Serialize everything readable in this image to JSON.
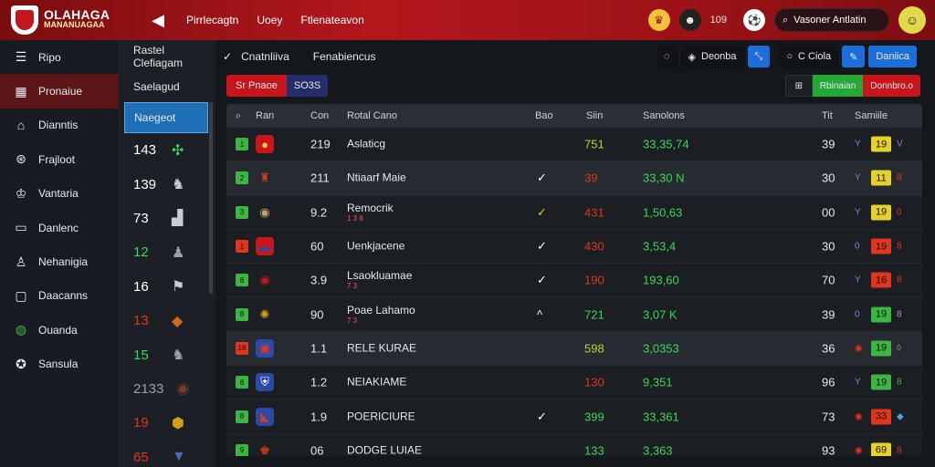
{
  "app": {
    "logo_line1": "OLAHAGA",
    "logo_line2": "MANANUAGAA"
  },
  "topnav": [
    "Pirrlecagtn",
    "Uoey",
    "Ftlenateavon"
  ],
  "top_right": {
    "count": "109",
    "search_value": "Vasoner Antlatin"
  },
  "sidebar": {
    "items": [
      {
        "label": "Ripo",
        "icon": "list-icon"
      },
      {
        "label": "Pronaiue",
        "icon": "calendar-icon"
      },
      {
        "label": "Dianntis",
        "icon": "bank-icon"
      },
      {
        "label": "Frajloot",
        "icon": "ball-icon"
      },
      {
        "label": "Vantaria",
        "icon": "crown-icon"
      },
      {
        "label": "Danlenc",
        "icon": "monitor-icon"
      },
      {
        "label": "Nehanigia",
        "icon": "runner-icon"
      },
      {
        "label": "Daacanns",
        "icon": "tv-icon"
      },
      {
        "label": "Ouanda",
        "icon": "globe-icon"
      },
      {
        "label": "Sansula",
        "icon": "soccer-icon"
      }
    ]
  },
  "midcol": {
    "header": "Rastel Clefiagam",
    "tabhead": "Saelagud",
    "selected": "Naegeot",
    "items": [
      {
        "value": "143",
        "color": "#ffffff",
        "icon": "✣",
        "icon_color": "#3dd65a"
      },
      {
        "value": "139",
        "color": "#ffffff",
        "icon": "♞",
        "icon_color": "#c8ccd2"
      },
      {
        "value": "73",
        "color": "#ffffff",
        "icon": "▟",
        "icon_color": "#c8ccd2"
      },
      {
        "value": "12",
        "color": "#3dd65a",
        "icon": "♟",
        "icon_color": "#9aa0a8"
      },
      {
        "value": "16",
        "color": "#ffffff",
        "icon": "⚑",
        "icon_color": "#c8ccd2"
      },
      {
        "value": "13",
        "color": "#e0361f",
        "icon": "◆",
        "icon_color": "#d2691e"
      },
      {
        "value": "15",
        "color": "#3dd65a",
        "icon": "♞",
        "icon_color": "#9aa0a8"
      },
      {
        "value": "2133",
        "color": "#9aa0a8",
        "icon": "◉",
        "icon_color": "#7a3b2a"
      },
      {
        "value": "19",
        "color": "#e0361f",
        "icon": "⬢",
        "icon_color": "#d4a017"
      },
      {
        "value": "65",
        "color": "#e0361f",
        "icon": "▼",
        "icon_color": "#4a6ab5"
      }
    ]
  },
  "toolbar": {
    "filter_label": "Cnatnliiva",
    "sort_label": "Fenabiencus",
    "btn1": "Deonba",
    "btn2": "C Ciola",
    "btn3": "Daniica",
    "seg_red": "Sr Pnaoe",
    "seg_blue": "SO3S",
    "green": "Rbinaian",
    "red": "Donnbro.o"
  },
  "table": {
    "headers": {
      "col1": "Ran",
      "col2": "Con",
      "col3": "Rotal Cano",
      "col4": "Bao",
      "col5": "Siin",
      "col6": "Sanolons",
      "col7": "Tit",
      "col8": "Samiile"
    },
    "rows": [
      {
        "badge": "1",
        "badge_color": "green",
        "emblem": "●",
        "emblem_bg": "#c8161b",
        "emblem_color": "#f4d03f",
        "con": "219",
        "name": "Aslaticg",
        "sub": "",
        "check": "",
        "check_color": "#ffffff",
        "siin": "751",
        "siin_color": "#b8d430",
        "sanolons": "33,35,74",
        "tit": "39",
        "mini1": "Y",
        "mini1_color": "#6a8de0",
        "chip": "19",
        "chip_color": "#e5d12a",
        "mini2": "V",
        "mini2_color": "#9b7cc9",
        "hl": false
      },
      {
        "badge": "2",
        "badge_color": "green",
        "emblem": "♜",
        "emblem_bg": "transparent",
        "emblem_color": "#e0361f",
        "con": "211",
        "name": "Ntiaarf Maie",
        "sub": "",
        "check": "✓",
        "check_color": "#ffffff",
        "siin": "39",
        "siin_color": "#e0361f",
        "sanolons": "33,30 N",
        "tit": "30",
        "mini1": "Y",
        "mini1_color": "#6a8de0",
        "chip": "11",
        "chip_color": "#e5d12a",
        "mini2": "8",
        "mini2_color": "#e0361f",
        "hl": true
      },
      {
        "badge": "3",
        "badge_color": "green",
        "emblem": "◉",
        "emblem_bg": "transparent",
        "emblem_color": "#c9a66b",
        "con": "9.2",
        "name": "Remocrik",
        "sub": "1 3 6",
        "check": "✓",
        "check_color": "#d7d42a",
        "siin": "431",
        "siin_color": "#e0361f",
        "sanolons": "1,50,63",
        "tit": "00",
        "mini1": "Y",
        "mini1_color": "#6a8de0",
        "chip": "19",
        "chip_color": "#e5d12a",
        "mini2": "0",
        "mini2_color": "#e0361f",
        "hl": false
      },
      {
        "badge": "1",
        "badge_color": "red",
        "emblem": "▬",
        "emblem_bg": "#c8161b",
        "emblem_color": "#2b4aa8",
        "con": "60",
        "name": "Uenkjacene",
        "sub": "",
        "check": "✓",
        "check_color": "#ffffff",
        "siin": "430",
        "siin_color": "#e0361f",
        "sanolons": "3,53,4",
        "tit": "30",
        "mini1": "0",
        "mini1_color": "#6a8de0",
        "chip": "19",
        "chip_color": "#e0361f",
        "mini2": "8",
        "mini2_color": "#e0361f",
        "hl": false
      },
      {
        "badge": "8",
        "badge_color": "green",
        "emblem": "◉",
        "emblem_bg": "transparent",
        "emblem_color": "#c8161b",
        "con": "3.9",
        "name": "Lsaokluamae",
        "sub": "7 3",
        "check": "✓",
        "check_color": "#ffffff",
        "siin": "190",
        "siin_color": "#e0361f",
        "sanolons": "193,60",
        "tit": "70",
        "mini1": "Y",
        "mini1_color": "#6a8de0",
        "chip": "16",
        "chip_color": "#e0361f",
        "mini2": "8",
        "mini2_color": "#e0361f",
        "hl": false
      },
      {
        "badge": "8",
        "badge_color": "green",
        "emblem": "✺",
        "emblem_bg": "transparent",
        "emblem_color": "#d4a017",
        "con": "90",
        "name": "Poae Lahamo",
        "sub": "7 3",
        "check": "^",
        "check_color": "#ffffff",
        "siin": "721",
        "siin_color": "#3dd65a",
        "sanolons": "3,07 K",
        "tit": "39",
        "mini1": "0",
        "mini1_color": "#6a8de0",
        "chip": "19",
        "chip_color": "#3db542",
        "mini2": "8",
        "mini2_color": "#9aa0a8",
        "hl": false
      },
      {
        "badge": "18",
        "badge_color": "red",
        "emblem": "▣",
        "emblem_bg": "#2b4aa8",
        "emblem_color": "#e0361f",
        "con": "1.1",
        "name": "RELE KURAE",
        "sub": "",
        "check": "",
        "check_color": "#ffffff",
        "siin": "598",
        "siin_color": "#b8d430",
        "sanolons": "3,0353",
        "tit": "36",
        "mini1": "◉",
        "mini1_color": "#e0361f",
        "chip": "19",
        "chip_color": "#3db542",
        "mini2": "◊",
        "mini2_color": "#9aa0a8",
        "hl": true
      },
      {
        "badge": "8",
        "badge_color": "green",
        "emblem": "⛨",
        "emblem_bg": "#2b4aa8",
        "emblem_color": "#ffffff",
        "con": "1.2",
        "name": "NEIAKIAME",
        "sub": "",
        "check": "",
        "check_color": "#ffffff",
        "siin": "130",
        "siin_color": "#e0361f",
        "sanolons": "9,351",
        "tit": "96",
        "mini1": "Y",
        "mini1_color": "#6a8de0",
        "chip": "19",
        "chip_color": "#3db542",
        "mini2": "8",
        "mini2_color": "#3db542",
        "hl": false
      },
      {
        "badge": "8",
        "badge_color": "green",
        "emblem": "◣",
        "emblem_bg": "#2b4aa8",
        "emblem_color": "#e0361f",
        "con": "1.9",
        "name": "POERICIURE",
        "sub": "",
        "check": "✓",
        "check_color": "#ffffff",
        "siin": "399",
        "siin_color": "#3dd65a",
        "sanolons": "33,361",
        "tit": "73",
        "mini1": "◉",
        "mini1_color": "#e0361f",
        "chip": "33",
        "chip_color": "#e0361f",
        "mini2": "◆",
        "mini2_color": "#4aa3e8",
        "hl": false
      },
      {
        "badge": "9",
        "badge_color": "green",
        "emblem": "♚",
        "emblem_bg": "transparent",
        "emblem_color": "#e0361f",
        "con": "06",
        "name": "DODGE LUIAE",
        "sub": "",
        "check": "",
        "check_color": "#ffffff",
        "siin": "133",
        "siin_color": "#3dd65a",
        "sanolons": "3,363",
        "tit": "93",
        "mini1": "◉",
        "mini1_color": "#e0361f",
        "chip": "69",
        "chip_color": "#e5d12a",
        "mini2": "8",
        "mini2_color": "#e0361f",
        "hl": false
      }
    ]
  }
}
